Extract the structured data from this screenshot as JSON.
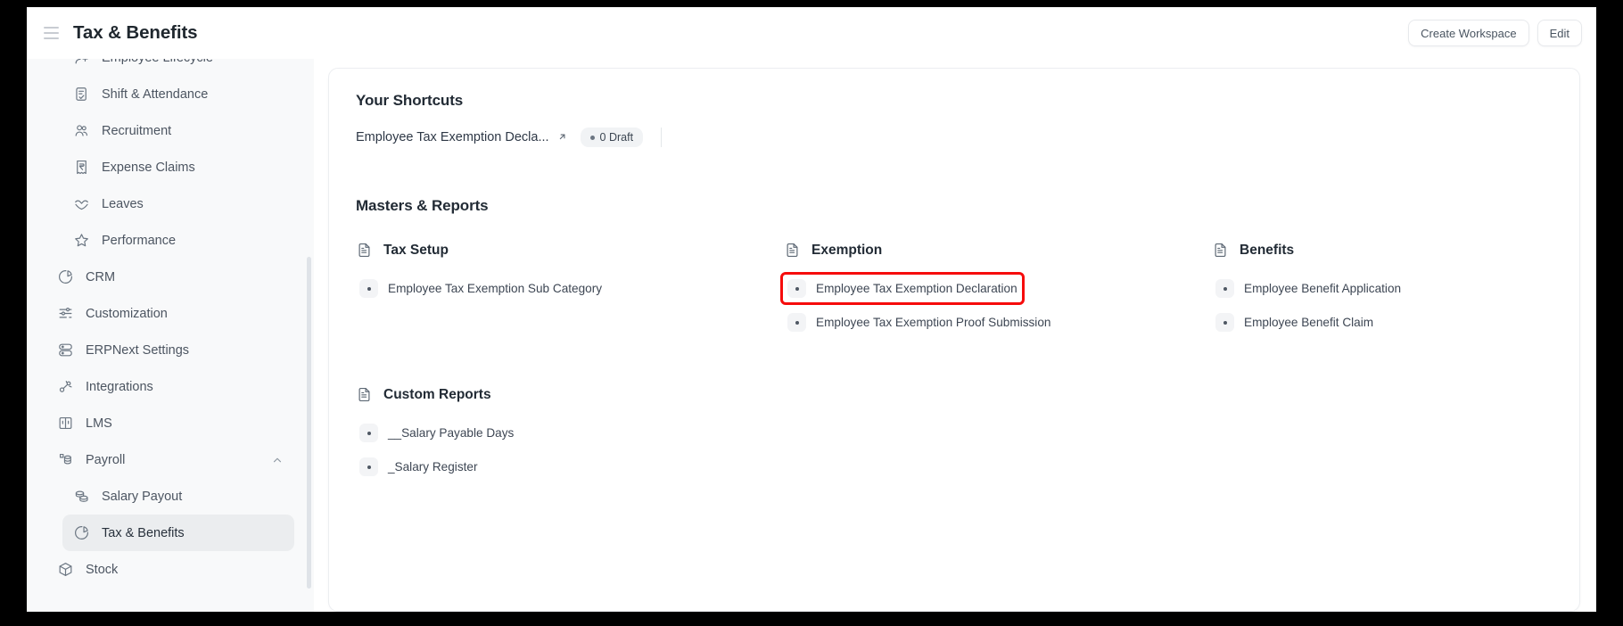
{
  "header": {
    "menu_icon": "hamburger-icon",
    "title": "Tax & Benefits",
    "create_workspace_label": "Create Workspace",
    "edit_label": "Edit"
  },
  "sidebar": {
    "items": [
      {
        "label": "Employee Lifecycle",
        "icon": "user-add-icon",
        "indent": true,
        "selected": false,
        "chevron": ""
      },
      {
        "label": "Shift & Attendance",
        "icon": "clipboard-check-icon",
        "indent": true,
        "selected": false,
        "chevron": ""
      },
      {
        "label": "Recruitment",
        "icon": "users-icon",
        "indent": true,
        "selected": false,
        "chevron": ""
      },
      {
        "label": "Expense Claims",
        "icon": "receipt-rupee-icon",
        "indent": true,
        "selected": false,
        "chevron": ""
      },
      {
        "label": "Leaves",
        "icon": "leaf-icon",
        "indent": true,
        "selected": false,
        "chevron": ""
      },
      {
        "label": "Performance",
        "icon": "star-icon",
        "indent": true,
        "selected": false,
        "chevron": ""
      },
      {
        "label": "CRM",
        "icon": "pie-chart-icon",
        "indent": false,
        "selected": false,
        "chevron": ""
      },
      {
        "label": "Customization",
        "icon": "sliders-icon",
        "indent": false,
        "selected": false,
        "chevron": ""
      },
      {
        "label": "ERPNext Settings",
        "icon": "database-icon",
        "indent": false,
        "selected": false,
        "chevron": ""
      },
      {
        "label": "Integrations",
        "icon": "integrations-icon",
        "indent": false,
        "selected": false,
        "chevron": ""
      },
      {
        "label": "LMS",
        "icon": "book-open-icon",
        "indent": false,
        "selected": false,
        "chevron": ""
      },
      {
        "label": "Payroll",
        "icon": "payroll-icon",
        "indent": false,
        "selected": false,
        "chevron": "chevron-up-icon"
      },
      {
        "label": "Salary Payout",
        "icon": "coins-icon",
        "indent": true,
        "selected": false,
        "chevron": ""
      },
      {
        "label": "Tax & Benefits",
        "icon": "pie-chart-icon",
        "indent": true,
        "selected": true,
        "chevron": ""
      },
      {
        "label": "Stock",
        "icon": "box-icon",
        "indent": false,
        "selected": false,
        "chevron": ""
      }
    ]
  },
  "main": {
    "shortcuts": {
      "title": "Your Shortcuts",
      "items": [
        {
          "label": "Employee Tax Exemption Decla...",
          "external_icon": "external-link-icon",
          "badge": "0 Draft"
        }
      ]
    },
    "masters": {
      "title": "Masters & Reports",
      "groups": [
        {
          "name": "Tax Setup",
          "icon": "document-icon",
          "links": [
            {
              "label": "Employee Tax Exemption Sub Category",
              "highlighted": false
            }
          ]
        },
        {
          "name": "Exemption",
          "icon": "document-icon",
          "links": [
            {
              "label": "Employee Tax Exemption Declaration",
              "highlighted": true
            },
            {
              "label": "Employee Tax Exemption Proof Submission",
              "highlighted": false
            }
          ]
        },
        {
          "name": "Benefits",
          "icon": "document-icon",
          "links": [
            {
              "label": "Employee Benefit Application",
              "highlighted": false
            },
            {
              "label": "Employee Benefit Claim",
              "highlighted": false
            }
          ]
        }
      ],
      "custom_reports": {
        "name": "Custom Reports",
        "icon": "document-icon",
        "links": [
          {
            "label": "__Salary Payable Days",
            "highlighted": false
          },
          {
            "label": "_Salary Register",
            "highlighted": false
          }
        ]
      }
    }
  },
  "colors": {
    "highlight": "#f60c0c",
    "selected_bg": "#ebedef",
    "sidebar_bg": "#f8f9fa",
    "text": "#3d4653"
  }
}
